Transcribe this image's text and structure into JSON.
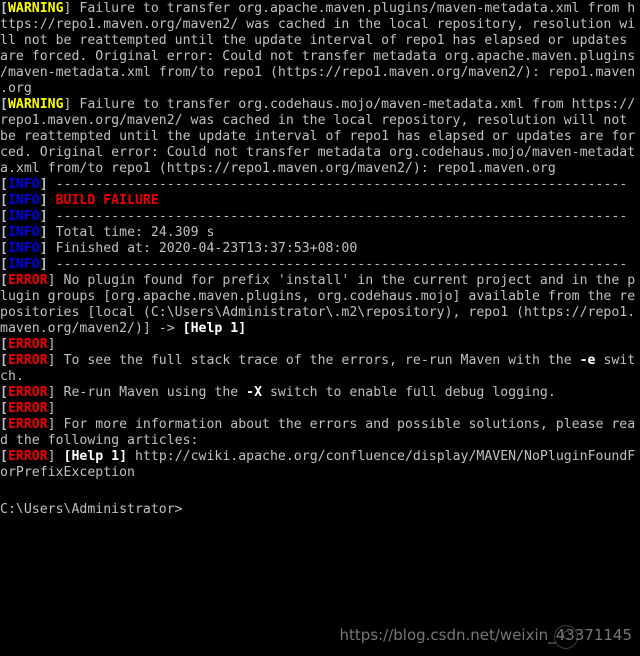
{
  "window": {
    "type": "windows-command-prompt",
    "background_color": "#000000",
    "foreground_color": "#c0c0c0",
    "info_color": "#0000ee",
    "warning_color": "#ffff00",
    "error_color": "#ee0000",
    "bright_color": "#ffffff"
  },
  "terminal": {
    "lines": [
      {
        "segs": [
          {
            "t": "[",
            "c": "bracket"
          },
          {
            "t": "WARNING",
            "c": "yellow"
          },
          {
            "t": "] Failure to transfer org.apache.maven.plugins/maven-metadata.xml from h",
            "c": "white"
          }
        ]
      },
      {
        "segs": [
          {
            "t": "ttps://repo1.maven.org/maven2/ was cached in the local repository, resolution wi",
            "c": "white"
          }
        ]
      },
      {
        "segs": [
          {
            "t": "ll not be reattempted until the update interval of repo1 has elapsed or updates",
            "c": "white"
          }
        ]
      },
      {
        "segs": [
          {
            "t": "are forced. Original error: Could not transfer metadata org.apache.maven.plugins",
            "c": "white"
          }
        ]
      },
      {
        "segs": [
          {
            "t": "/maven-metadata.xml from/to repo1 (https://repo1.maven.org/maven2/): repo1.maven",
            "c": "white"
          }
        ]
      },
      {
        "segs": [
          {
            "t": ".org",
            "c": "white"
          }
        ]
      },
      {
        "segs": [
          {
            "t": "[",
            "c": "bracket"
          },
          {
            "t": "WARNING",
            "c": "yellow"
          },
          {
            "t": "] Failure to transfer org.codehaus.mojo/maven-metadata.xml from https://",
            "c": "white"
          }
        ]
      },
      {
        "segs": [
          {
            "t": "repo1.maven.org/maven2/ was cached in the local repository, resolution will not",
            "c": "white"
          }
        ]
      },
      {
        "segs": [
          {
            "t": "be reattempted until the update interval of repo1 has elapsed or updates are for",
            "c": "white"
          }
        ]
      },
      {
        "segs": [
          {
            "t": "ced. Original error: Could not transfer metadata org.codehaus.mojo/maven-metadat",
            "c": "white"
          }
        ]
      },
      {
        "segs": [
          {
            "t": "a.xml from/to repo1 (https://repo1.maven.org/maven2/): repo1.maven.org",
            "c": "white"
          }
        ]
      },
      {
        "segs": [
          {
            "t": "[",
            "c": "bracket"
          },
          {
            "t": "INFO",
            "c": "blue"
          },
          {
            "t": "] ",
            "c": "bracket"
          },
          {
            "t": "------------------------------------------------------------------------",
            "c": "white"
          }
        ]
      },
      {
        "segs": [
          {
            "t": "[",
            "c": "bracket"
          },
          {
            "t": "INFO",
            "c": "blue"
          },
          {
            "t": "] ",
            "c": "bracket"
          },
          {
            "t": "BUILD FAILURE",
            "c": "red"
          }
        ]
      },
      {
        "segs": [
          {
            "t": "[",
            "c": "bracket"
          },
          {
            "t": "INFO",
            "c": "blue"
          },
          {
            "t": "] ",
            "c": "bracket"
          },
          {
            "t": "------------------------------------------------------------------------",
            "c": "white"
          }
        ]
      },
      {
        "segs": [
          {
            "t": "[",
            "c": "bracket"
          },
          {
            "t": "INFO",
            "c": "blue"
          },
          {
            "t": "] ",
            "c": "bracket"
          },
          {
            "t": "Total time: 24.309 s",
            "c": "white"
          }
        ]
      },
      {
        "segs": [
          {
            "t": "[",
            "c": "bracket"
          },
          {
            "t": "INFO",
            "c": "blue"
          },
          {
            "t": "] ",
            "c": "bracket"
          },
          {
            "t": "Finished at: 2020-04-23T13:37:53+08:00",
            "c": "white"
          }
        ]
      },
      {
        "segs": [
          {
            "t": "[",
            "c": "bracket"
          },
          {
            "t": "INFO",
            "c": "blue"
          },
          {
            "t": "] ",
            "c": "bracket"
          },
          {
            "t": "------------------------------------------------------------------------",
            "c": "white"
          }
        ]
      },
      {
        "segs": [
          {
            "t": "[",
            "c": "bracket"
          },
          {
            "t": "ERROR",
            "c": "red"
          },
          {
            "t": "] No plugin found for prefix 'install' in the current project and in the p",
            "c": "white"
          }
        ]
      },
      {
        "segs": [
          {
            "t": "lugin groups [org.apache.maven.plugins, org.codehaus.mojo] available from the re",
            "c": "white"
          }
        ]
      },
      {
        "segs": [
          {
            "t": "positories [local (C:\\Users\\Administrator\\.m2\\repository), repo1 (https://repo1.",
            "c": "white"
          }
        ]
      },
      {
        "segs": [
          {
            "t": "maven.org/maven2/)] -> ",
            "c": "white"
          },
          {
            "t": "[Help 1]",
            "c": "bwhite"
          }
        ]
      },
      {
        "segs": [
          {
            "t": "[",
            "c": "bracket"
          },
          {
            "t": "ERROR",
            "c": "red"
          },
          {
            "t": "]",
            "c": "white"
          }
        ]
      },
      {
        "segs": [
          {
            "t": "[",
            "c": "bracket"
          },
          {
            "t": "ERROR",
            "c": "red"
          },
          {
            "t": "] To see the full stack trace of the errors, re-run Maven with the ",
            "c": "white"
          },
          {
            "t": "-e",
            "c": "bwhite"
          },
          {
            "t": " swit",
            "c": "white"
          }
        ]
      },
      {
        "segs": [
          {
            "t": "ch.",
            "c": "white"
          }
        ]
      },
      {
        "segs": [
          {
            "t": "[",
            "c": "bracket"
          },
          {
            "t": "ERROR",
            "c": "red"
          },
          {
            "t": "] Re-run Maven using the ",
            "c": "white"
          },
          {
            "t": "-X",
            "c": "bwhite"
          },
          {
            "t": " switch to enable full debug logging.",
            "c": "white"
          }
        ]
      },
      {
        "segs": [
          {
            "t": "[",
            "c": "bracket"
          },
          {
            "t": "ERROR",
            "c": "red"
          },
          {
            "t": "]",
            "c": "white"
          }
        ]
      },
      {
        "segs": [
          {
            "t": "[",
            "c": "bracket"
          },
          {
            "t": "ERROR",
            "c": "red"
          },
          {
            "t": "] For more information about the errors and possible solutions, please rea",
            "c": "white"
          }
        ]
      },
      {
        "segs": [
          {
            "t": "d the following articles:",
            "c": "white"
          }
        ]
      },
      {
        "segs": [
          {
            "t": "[",
            "c": "bracket"
          },
          {
            "t": "ERROR",
            "c": "red"
          },
          {
            "t": "] ",
            "c": "white"
          },
          {
            "t": "[Help 1]",
            "c": "bwhite"
          },
          {
            "t": " http://cwiki.apache.org/confluence/display/MAVEN/NoPluginFoundF",
            "c": "white"
          }
        ]
      },
      {
        "segs": [
          {
            "t": "orPrefixException",
            "c": "white"
          }
        ]
      },
      {
        "segs": [
          {
            "t": "",
            "c": "white"
          }
        ]
      },
      {
        "segs": [
          {
            "t": "C:\\Users\\Administrator>",
            "c": "white"
          }
        ],
        "cursor": true
      }
    ]
  },
  "watermark": {
    "url": "https://blog.csdn.net/weixin_43371145",
    "logo_glyph": "C"
  }
}
